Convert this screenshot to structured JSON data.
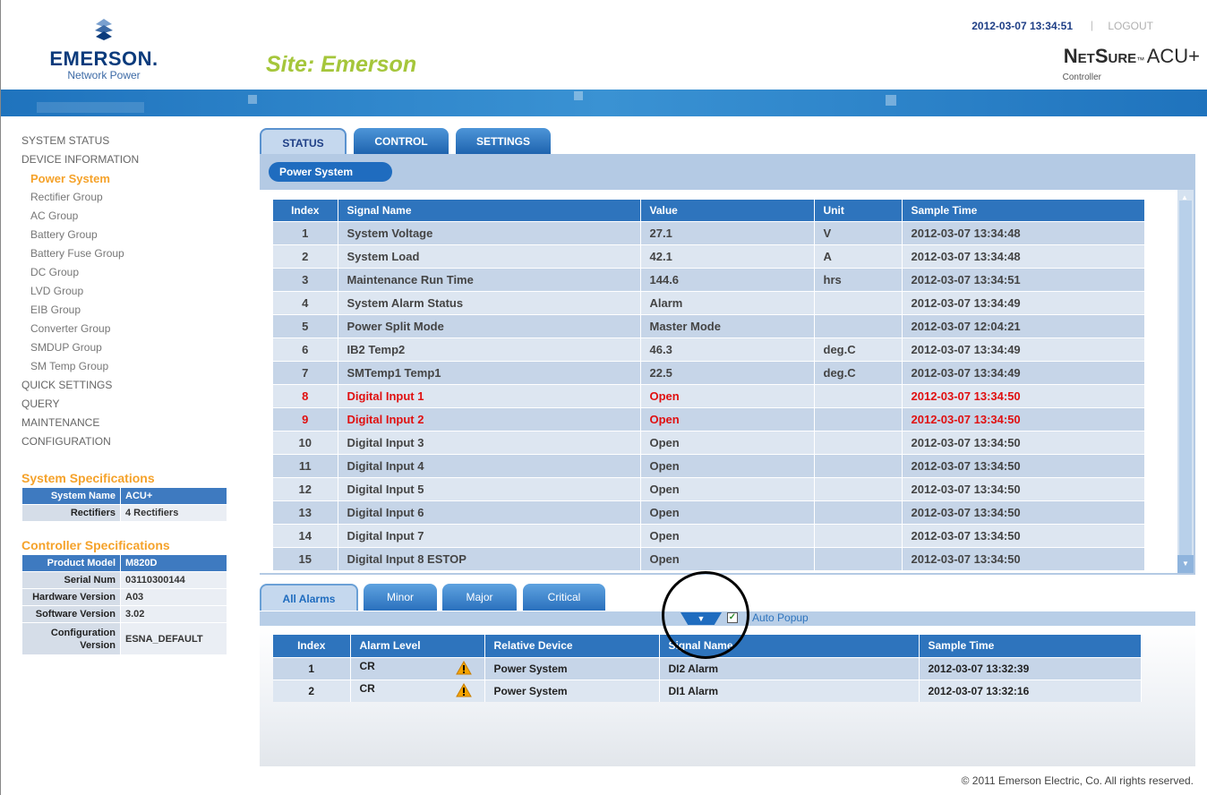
{
  "header": {
    "brand_name": "EMERSON.",
    "brand_sub": "Network Power",
    "site_title": "Site: Emerson",
    "datetime": "2012-03-07 13:34:51",
    "separator": "|",
    "logout": "LOGOUT",
    "product_name": "NetSure",
    "product_suffix": "ACU+",
    "product_sub": "Controller"
  },
  "sidebar": {
    "items": [
      {
        "label": "SYSTEM STATUS"
      },
      {
        "label": "DEVICE INFORMATION"
      },
      {
        "label": "Power System"
      },
      {
        "label": "Rectifier Group"
      },
      {
        "label": "AC Group"
      },
      {
        "label": "Battery Group"
      },
      {
        "label": "Battery Fuse Group"
      },
      {
        "label": "DC Group"
      },
      {
        "label": "LVD Group"
      },
      {
        "label": "EIB Group"
      },
      {
        "label": "Converter Group"
      },
      {
        "label": "SMDUP Group"
      },
      {
        "label": "SM Temp Group"
      },
      {
        "label": "QUICK SETTINGS"
      },
      {
        "label": "QUERY"
      },
      {
        "label": "MAINTENANCE"
      },
      {
        "label": "CONFIGURATION"
      }
    ]
  },
  "system_specs": {
    "title": "System Specifications",
    "rows": [
      {
        "key": "System Name",
        "value": "ACU+"
      },
      {
        "key": "Rectifiers",
        "value": "4 Rectifiers"
      }
    ]
  },
  "controller_specs": {
    "title": "Controller Specifications",
    "rows": [
      {
        "key": "Product Model",
        "value": "M820D"
      },
      {
        "key": "Serial Num",
        "value": "03110300144"
      },
      {
        "key": "Hardware Version",
        "value": "A03"
      },
      {
        "key": "Software Version",
        "value": "3.02"
      },
      {
        "key": "Configuration Version",
        "value": "ESNA_DEFAULT"
      }
    ]
  },
  "tabs": {
    "status": "STATUS",
    "control": "CONTROL",
    "settings": "SETTINGS"
  },
  "breadcrumb": "Power System",
  "signal_table": {
    "headers": [
      "Index",
      "Signal Name",
      "Value",
      "Unit",
      "Sample Time"
    ],
    "rows": [
      {
        "index": "1",
        "name": "System Voltage",
        "value": "27.1",
        "unit": "V",
        "time": "2012-03-07 13:34:48"
      },
      {
        "index": "2",
        "name": "System Load",
        "value": "42.1",
        "unit": "A",
        "time": "2012-03-07 13:34:48"
      },
      {
        "index": "3",
        "name": "Maintenance Run Time",
        "value": "144.6",
        "unit": "hrs",
        "time": "2012-03-07 13:34:51"
      },
      {
        "index": "4",
        "name": "System Alarm Status",
        "value": "Alarm",
        "unit": "",
        "time": "2012-03-07 13:34:49"
      },
      {
        "index": "5",
        "name": "Power Split Mode",
        "value": "Master Mode",
        "unit": "",
        "time": "2012-03-07 12:04:21"
      },
      {
        "index": "6",
        "name": "IB2 Temp2",
        "value": "46.3",
        "unit": "deg.C",
        "time": "2012-03-07 13:34:49"
      },
      {
        "index": "7",
        "name": "SMTemp1 Temp1",
        "value": "22.5",
        "unit": "deg.C",
        "time": "2012-03-07 13:34:49"
      },
      {
        "index": "8",
        "name": "Digital Input 1",
        "value": "Open",
        "unit": "",
        "time": "2012-03-07 13:34:50"
      },
      {
        "index": "9",
        "name": "Digital Input 2",
        "value": "Open",
        "unit": "",
        "time": "2012-03-07 13:34:50"
      },
      {
        "index": "10",
        "name": "Digital Input 3",
        "value": "Open",
        "unit": "",
        "time": "2012-03-07 13:34:50"
      },
      {
        "index": "11",
        "name": "Digital Input 4",
        "value": "Open",
        "unit": "",
        "time": "2012-03-07 13:34:50"
      },
      {
        "index": "12",
        "name": "Digital Input 5",
        "value": "Open",
        "unit": "",
        "time": "2012-03-07 13:34:50"
      },
      {
        "index": "13",
        "name": "Digital Input 6",
        "value": "Open",
        "unit": "",
        "time": "2012-03-07 13:34:50"
      },
      {
        "index": "14",
        "name": "Digital Input 7",
        "value": "Open",
        "unit": "",
        "time": "2012-03-07 13:34:50"
      },
      {
        "index": "15",
        "name": "Digital Input 8 ESTOP",
        "value": "Open",
        "unit": "",
        "time": "2012-03-07 13:34:50"
      }
    ]
  },
  "alarm_tabs": {
    "all": "All Alarms",
    "minor": "Minor",
    "major": "Major",
    "critical": "Critical"
  },
  "auto_popup": {
    "label": "Auto Popup",
    "checked": true
  },
  "alarm_table": {
    "headers": [
      "Index",
      "Alarm Level",
      "Relative Device",
      "Signal Name",
      "Sample Time"
    ],
    "rows": [
      {
        "index": "1",
        "level": "CR",
        "device": "Power System",
        "signal": "DI2 Alarm",
        "time": "2012-03-07 13:32:39"
      },
      {
        "index": "2",
        "level": "CR",
        "device": "Power System",
        "signal": "DI1 Alarm",
        "time": "2012-03-07 13:32:16"
      }
    ]
  },
  "footer": "© 2011 Emerson Electric, Co. All rights reserved.",
  "colors": {
    "brand_blue": "#1f6cbf",
    "accent_orange": "#f5a22a",
    "site_green": "#a5c63b",
    "alarm_red": "#e01010"
  }
}
